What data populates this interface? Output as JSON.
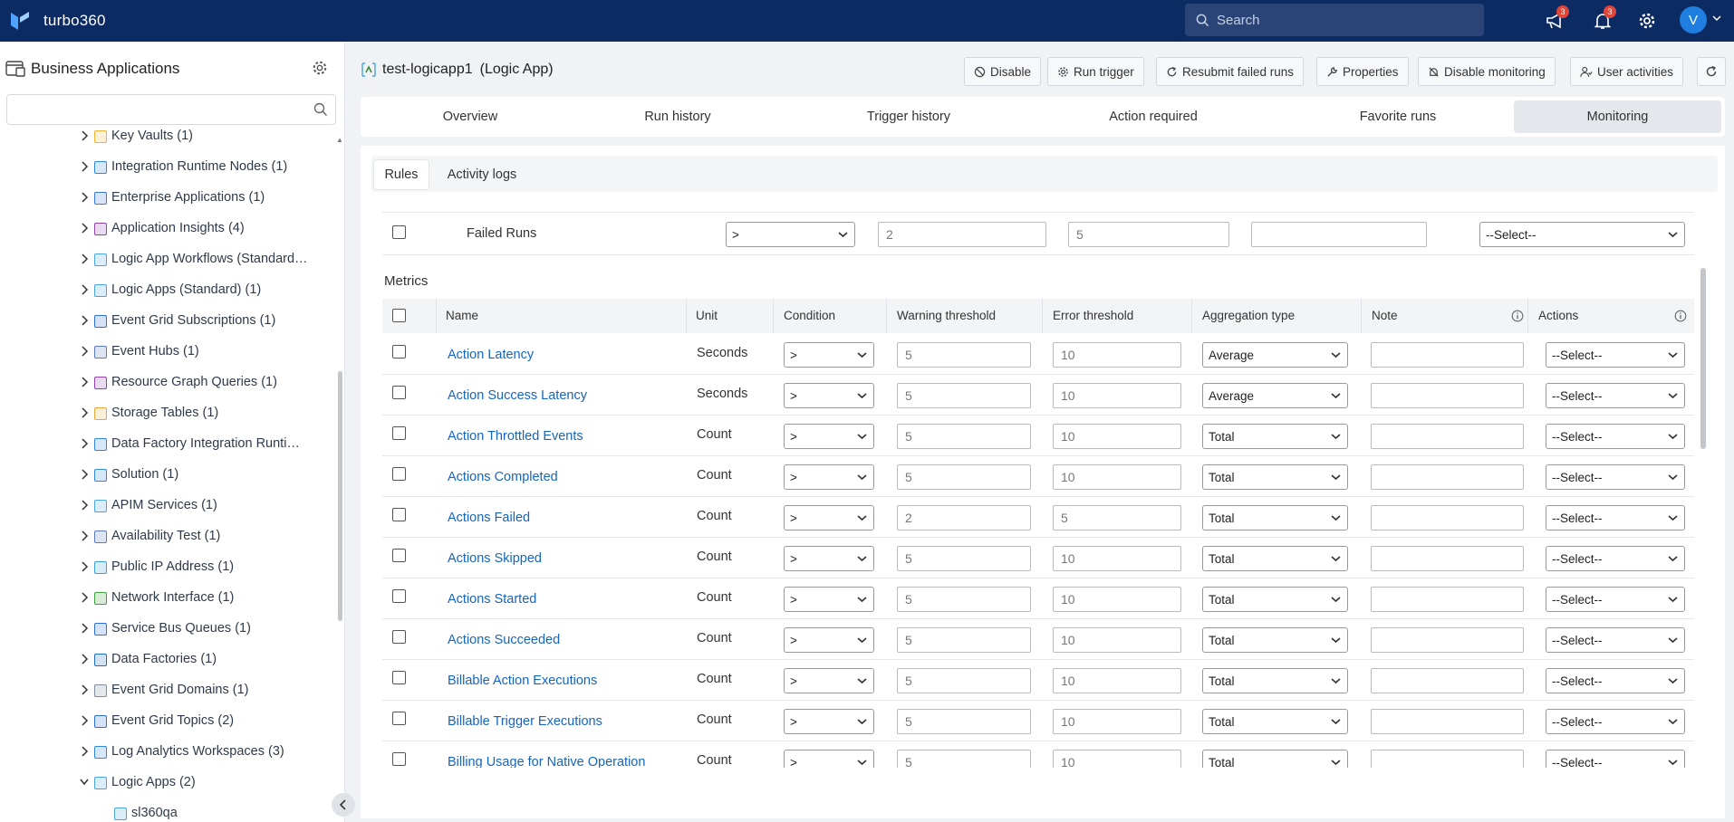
{
  "topbar": {
    "brand": "turbo360",
    "search_placeholder": "Search",
    "messages_badge": "3",
    "alerts_badge": "3",
    "avatar_initial": "V"
  },
  "sidebar": {
    "title": "Business Applications",
    "items": [
      {
        "label": "Key Vaults (1)",
        "icon_color": "#f2b233"
      },
      {
        "label": "Integration Runtime Nodes (1)",
        "icon_color": "#2e86de"
      },
      {
        "label": "Enterprise Applications (1)",
        "icon_color": "#3c78d8"
      },
      {
        "label": "Application Insights (4)",
        "icon_color": "#8e44ad"
      },
      {
        "label": "Logic App Workflows (Standard…",
        "icon_color": "#4aa3df"
      },
      {
        "label": "Logic Apps (Standard) (1)",
        "icon_color": "#4aa3df"
      },
      {
        "label": "Event Grid Subscriptions (1)",
        "icon_color": "#2e6fd6"
      },
      {
        "label": "Event Hubs (1)",
        "icon_color": "#5a7bbf"
      },
      {
        "label": "Resource Graph Queries (1)",
        "icon_color": "#8e44ad"
      },
      {
        "label": "Storage Tables (1)",
        "icon_color": "#e3a93b"
      },
      {
        "label": "Data Factory Integration Runti…",
        "icon_color": "#2e86de"
      },
      {
        "label": "Solution (1)",
        "icon_color": "#2e86de"
      },
      {
        "label": "APIM Services (1)",
        "icon_color": "#4aa3df"
      },
      {
        "label": "Availability Test (1)",
        "icon_color": "#5a7bbf"
      },
      {
        "label": "Public IP Address (1)",
        "icon_color": "#3aa0d8"
      },
      {
        "label": "Network Interface (1)",
        "icon_color": "#3e9f3e"
      },
      {
        "label": "Service Bus Queues (1)",
        "icon_color": "#2e6fd6"
      },
      {
        "label": "Data Factories (1)",
        "icon_color": "#1e6fbf"
      },
      {
        "label": "Event Grid Domains (1)",
        "icon_color": "#7f8c9d"
      },
      {
        "label": "Event Grid Topics (2)",
        "icon_color": "#2e6fd6"
      },
      {
        "label": "Log Analytics Workspaces (3)",
        "icon_color": "#2e86de"
      },
      {
        "label": "Logic Apps (2)",
        "icon_color": "#4aa3df",
        "expanded": true
      },
      {
        "label": "sl360qa",
        "icon_color": "#4aa3df",
        "child": true
      }
    ]
  },
  "header": {
    "resource_name": "test-logicapp1",
    "resource_type": "(Logic App)",
    "buttons": [
      "Disable",
      "Run trigger",
      "Resubmit failed runs",
      "Properties",
      "Disable monitoring",
      "User activities"
    ]
  },
  "tabs": [
    "Overview",
    "Run history",
    "Trigger history",
    "Action required",
    "Favorite runs",
    "Monitoring"
  ],
  "active_tab": "Monitoring",
  "subtabs": [
    "Rules",
    "Activity logs"
  ],
  "status_rule": {
    "name": "Failed Runs",
    "condition": ">",
    "warning": "2",
    "error": "5",
    "note": "",
    "action": "--Select--"
  },
  "metrics": {
    "section_label": "Metrics",
    "headers": [
      "Name",
      "Unit",
      "Condition",
      "Warning threshold",
      "Error threshold",
      "Aggregation type",
      "Note",
      "Actions"
    ],
    "rows": [
      {
        "name": "Action Latency",
        "unit": "Seconds",
        "condition": ">",
        "warning": "5",
        "error": "10",
        "aggregation": "Average",
        "action": "--Select--"
      },
      {
        "name": "Action Success Latency",
        "unit": "Seconds",
        "condition": ">",
        "warning": "5",
        "error": "10",
        "aggregation": "Average",
        "action": "--Select--"
      },
      {
        "name": "Action Throttled Events",
        "unit": "Count",
        "condition": ">",
        "warning": "5",
        "error": "10",
        "aggregation": "Total",
        "action": "--Select--"
      },
      {
        "name": "Actions Completed",
        "unit": "Count",
        "condition": ">",
        "warning": "5",
        "error": "10",
        "aggregation": "Total",
        "action": "--Select--"
      },
      {
        "name": "Actions Failed",
        "unit": "Count",
        "condition": ">",
        "warning": "2",
        "error": "5",
        "aggregation": "Total",
        "action": "--Select--"
      },
      {
        "name": "Actions Skipped",
        "unit": "Count",
        "condition": ">",
        "warning": "5",
        "error": "10",
        "aggregation": "Total",
        "action": "--Select--"
      },
      {
        "name": "Actions Started",
        "unit": "Count",
        "condition": ">",
        "warning": "5",
        "error": "10",
        "aggregation": "Total",
        "action": "--Select--"
      },
      {
        "name": "Actions Succeeded",
        "unit": "Count",
        "condition": ">",
        "warning": "5",
        "error": "10",
        "aggregation": "Total",
        "action": "--Select--"
      },
      {
        "name": "Billable Action Executions",
        "unit": "Count",
        "condition": ">",
        "warning": "5",
        "error": "10",
        "aggregation": "Total",
        "action": "--Select--"
      },
      {
        "name": "Billable Trigger Executions",
        "unit": "Count",
        "condition": ">",
        "warning": "5",
        "error": "10",
        "aggregation": "Total",
        "action": "--Select--"
      },
      {
        "name": "Billing Usage for Native Operation",
        "unit": "Count",
        "condition": ">",
        "warning": "5",
        "error": "10",
        "aggregation": "Total",
        "action": "--Select--"
      }
    ]
  },
  "colors": {
    "topbar": "#0d2b63",
    "link": "#1565c0",
    "badge": "#e0453a",
    "avatar": "#1f7fe0"
  }
}
